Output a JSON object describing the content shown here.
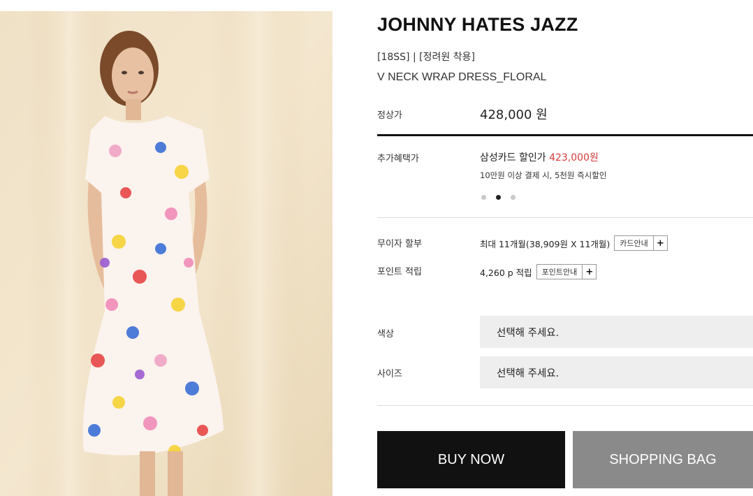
{
  "product": {
    "brand": "JOHNNY HATES JAZZ",
    "season_tag": "[18SS] | [정려원 착용]",
    "name": "V NECK WRAP DRESS_FLORAL"
  },
  "price": {
    "label": "정상가",
    "value": "428,000 원"
  },
  "benefit": {
    "label": "추가혜택가",
    "card_text": "삼성카드 할인가 ",
    "card_price": "423,000원",
    "note": "10만원 이상 결제 시, 5천원 즉시할인",
    "carousel_active_index": 1,
    "carousel_count": 3
  },
  "installment": {
    "label": "무이자 할부",
    "text": "최대 11개월(38,909원 X 11개월)",
    "guide_label": "카드안내",
    "plus": "+"
  },
  "points": {
    "label": "포인트 적립",
    "text": "4,260 p 적립",
    "guide_label": "포인트안내",
    "plus": "+"
  },
  "options": {
    "color_label": "색상",
    "color_placeholder": "선택해 주세요.",
    "size_label": "사이즈",
    "size_placeholder": "선택해 주세요."
  },
  "actions": {
    "buy_now": "BUY NOW",
    "shopping_bag": "SHOPPING BAG"
  },
  "colors": {
    "accent_red": "#d63a3a",
    "buy_bg": "#111111",
    "bag_bg": "#8a8a8a"
  }
}
